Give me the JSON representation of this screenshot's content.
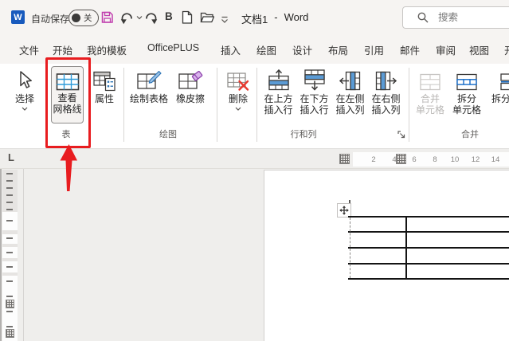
{
  "titlebar": {
    "logo_letter": "W",
    "autosave_label": "自动保存",
    "autosave_state": "关",
    "qat_bold_label": "B",
    "doc_title": "文档1",
    "title_separator": "-",
    "app_name": "Word",
    "search_placeholder": "搜索"
  },
  "tabs": [
    "文件",
    "开始",
    "我的模板",
    "OfficePLUS",
    "插入",
    "绘图",
    "设计",
    "布局",
    "引用",
    "邮件",
    "审阅",
    "视图",
    "开"
  ],
  "ribbon": {
    "select_label": "选择",
    "view_gridlines_line1": "查看",
    "view_gridlines_line2": "网格线",
    "properties_label": "属性",
    "draw_table_label": "绘制表格",
    "eraser_label": "橡皮擦",
    "delete_label": "删除",
    "insert_above_line1": "在上方",
    "insert_above_line2": "插入行",
    "insert_below_line1": "在下方",
    "insert_below_line2": "插入行",
    "insert_left_line1": "在左侧",
    "insert_left_line2": "插入列",
    "insert_right_line1": "在右侧",
    "insert_right_line2": "插入列",
    "merge_cells_line1": "合并",
    "merge_cells_line2": "单元格",
    "split_cells_line1": "拆分",
    "split_cells_line2": "单元格",
    "split_table_label": "拆分表格",
    "group_table": "表",
    "group_draw": "绘图",
    "group_rows_cols": "行和列",
    "group_merge": "合并"
  },
  "ruler": {
    "numbers": [
      "2",
      "4",
      "6",
      "8",
      "10",
      "12",
      "14"
    ]
  },
  "document": {
    "table_rows": 4,
    "table_columns": 2
  },
  "colors": {
    "annotation_red": "#e81c1f",
    "gridline_blue": "#2f9bd8",
    "insert_fill_blue": "#5b9bd5",
    "eraser_purple": "#a254c4",
    "save_magenta": "#c03fae",
    "delete_red": "#e8392f",
    "word_blue": "#185abd"
  }
}
